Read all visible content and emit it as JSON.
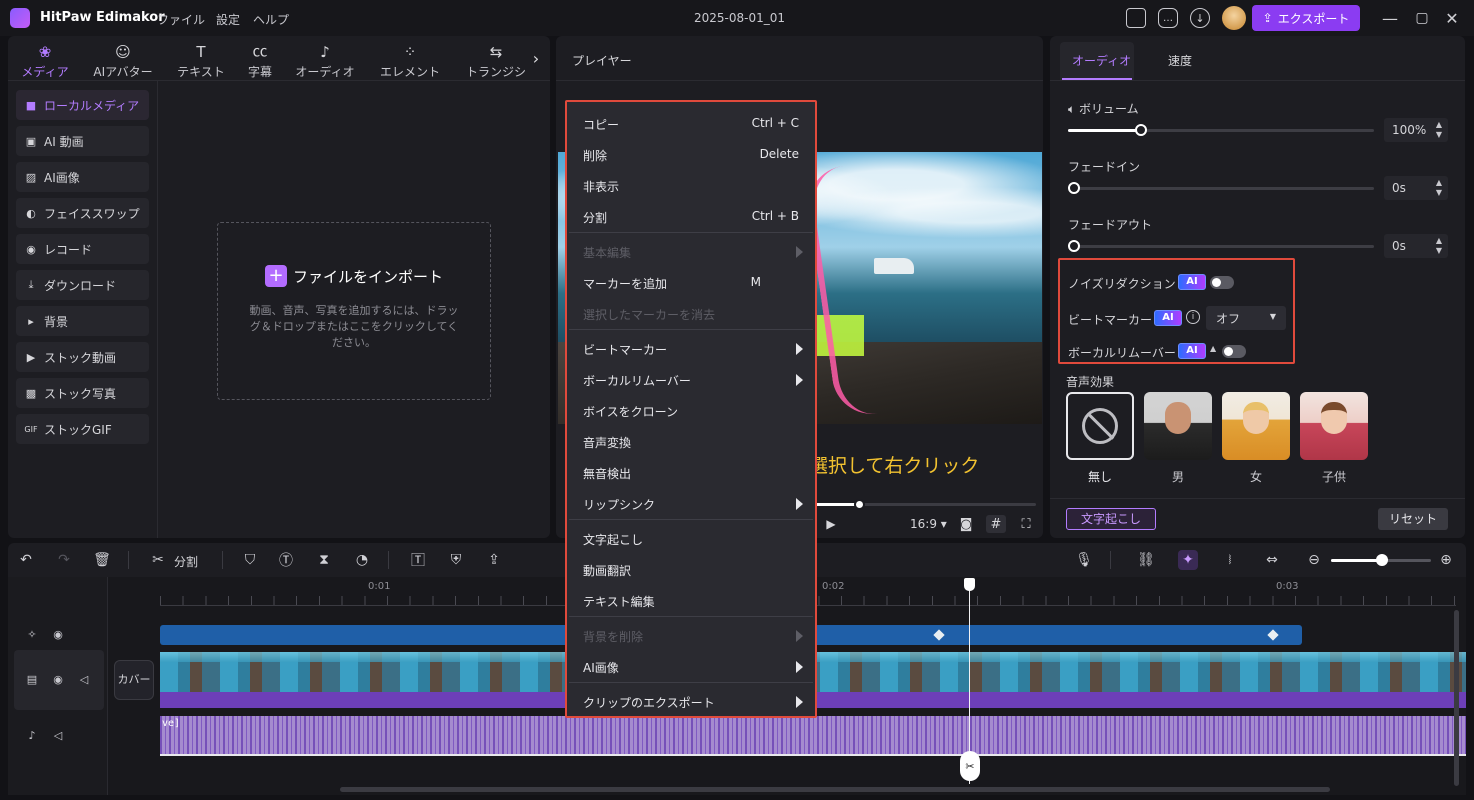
{
  "app": {
    "name": "HitPaw Edimakor",
    "menus": [
      "ファイル",
      "設定",
      "ヘルプ"
    ],
    "document_title": "2025-08-01_01",
    "export_label": "エクスポート"
  },
  "media_tabs": [
    {
      "label": "メディア",
      "icon": "media-icon"
    },
    {
      "label": "AIアバター",
      "icon": "avatar-icon"
    },
    {
      "label": "テキスト",
      "icon": "text-icon"
    },
    {
      "label": "字幕",
      "icon": "caption-icon"
    },
    {
      "label": "オーディオ",
      "icon": "music-icon"
    },
    {
      "label": "エレメント",
      "icon": "element-icon"
    },
    {
      "label": "トランジシ",
      "icon": "transition-icon"
    }
  ],
  "sidebar": {
    "items": [
      {
        "label": "ローカルメディア",
        "icon": "folder-icon"
      },
      {
        "label": "AI 動画",
        "icon": "ai-video-icon"
      },
      {
        "label": "AI画像",
        "icon": "ai-image-icon"
      },
      {
        "label": "フェイススワップ",
        "icon": "face-swap-icon"
      },
      {
        "label": "レコード",
        "icon": "record-icon"
      },
      {
        "label": "ダウンロード",
        "icon": "download-icon"
      },
      {
        "label": "背景",
        "icon": "play-triangle-icon"
      },
      {
        "label": "ストック動画",
        "icon": "stock-video-icon"
      },
      {
        "label": "ストック写真",
        "icon": "stock-photo-icon"
      },
      {
        "label": "ストックGIF",
        "icon": "gif-icon"
      }
    ]
  },
  "import": {
    "title": "ファイルをインポート",
    "description": "動画、音声、写真を追加するには、ドラッグ＆ドロップまたはここをクリックしてください。"
  },
  "player": {
    "title": "プレイヤー",
    "aspect_ratio": "16:9",
    "progress_fraction": 0.2
  },
  "overlay_text": "トラックを選択して右クリック",
  "context_menu": {
    "items": [
      {
        "label": "コピー",
        "shortcut": "Ctrl + C"
      },
      {
        "label": "削除",
        "shortcut": "Delete"
      },
      {
        "label": "非表示",
        "shortcut": ""
      },
      {
        "label": "分割",
        "shortcut": "Ctrl + B"
      },
      {
        "label": "基本編集",
        "shortcut": ""
      },
      {
        "label": "マーカーを追加",
        "shortcut": "M"
      },
      {
        "label": "選択したマーカーを消去",
        "shortcut": ""
      },
      {
        "label": "ビートマーカー",
        "shortcut": ""
      },
      {
        "label": "ボーカルリムーバー",
        "shortcut": ""
      },
      {
        "label": "ボイスをクローン",
        "shortcut": ""
      },
      {
        "label": "音声変換",
        "shortcut": ""
      },
      {
        "label": "無音検出",
        "shortcut": ""
      },
      {
        "label": "リップシンク",
        "shortcut": ""
      },
      {
        "label": "文字起こし",
        "shortcut": ""
      },
      {
        "label": "動画翻訳",
        "shortcut": ""
      },
      {
        "label": "テキスト編集",
        "shortcut": ""
      },
      {
        "label": "背景を削除",
        "shortcut": ""
      },
      {
        "label": "AI画像",
        "shortcut": ""
      },
      {
        "label": "クリップのエクスポート",
        "shortcut": ""
      }
    ]
  },
  "right_panel": {
    "tabs": [
      "オーディオ",
      "速度"
    ],
    "volume_label": "ボリューム",
    "volume_value": "100%",
    "volume_fraction": 0.24,
    "fade_in_label": "フェードイン",
    "fade_in_value": "0s",
    "fade_out_label": "フェードアウト",
    "fade_out_value": "0s",
    "noise_reduction_label": "ノイズリダクション",
    "beat_marker_label": "ビートマーカー",
    "beat_marker_value": "オフ",
    "vocal_remover_label": "ボーカルリムーバー",
    "ai_badge": "AI",
    "sound_effect_label": "音声効果",
    "voices": [
      "無し",
      "男",
      "女",
      "子供"
    ],
    "transcribe_label": "文字起こし",
    "reset_label": "リセット"
  },
  "timeline": {
    "split_label": "分割",
    "ticks": [
      "0:01",
      "0:02",
      "0:03"
    ],
    "cover_label": "カバー",
    "audio_clip_label": "ve]"
  },
  "colors": {
    "accent": "#8b3cf2",
    "highlight_border": "#e04a3c",
    "overlay_text": "#f2c230",
    "effect_track": "#1f5fa8"
  }
}
